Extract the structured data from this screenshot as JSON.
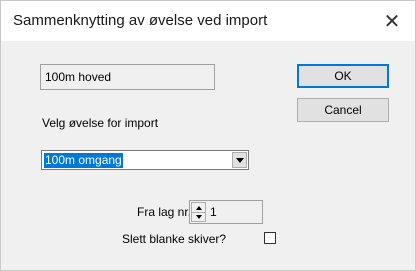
{
  "window": {
    "title": "Sammenknytting av øvelse ved import",
    "close_glyph": "✕"
  },
  "source_event": "100m hoved",
  "buttons": {
    "ok": "OK",
    "cancel": "Cancel"
  },
  "select_label": "Velg øvelse for import",
  "event_select": {
    "selected": "100m omgang"
  },
  "from_team": {
    "label": "Fra lag nr.",
    "value": "1"
  },
  "delete_blank": {
    "label": "Slett blanke skiver?",
    "checked": false
  }
}
